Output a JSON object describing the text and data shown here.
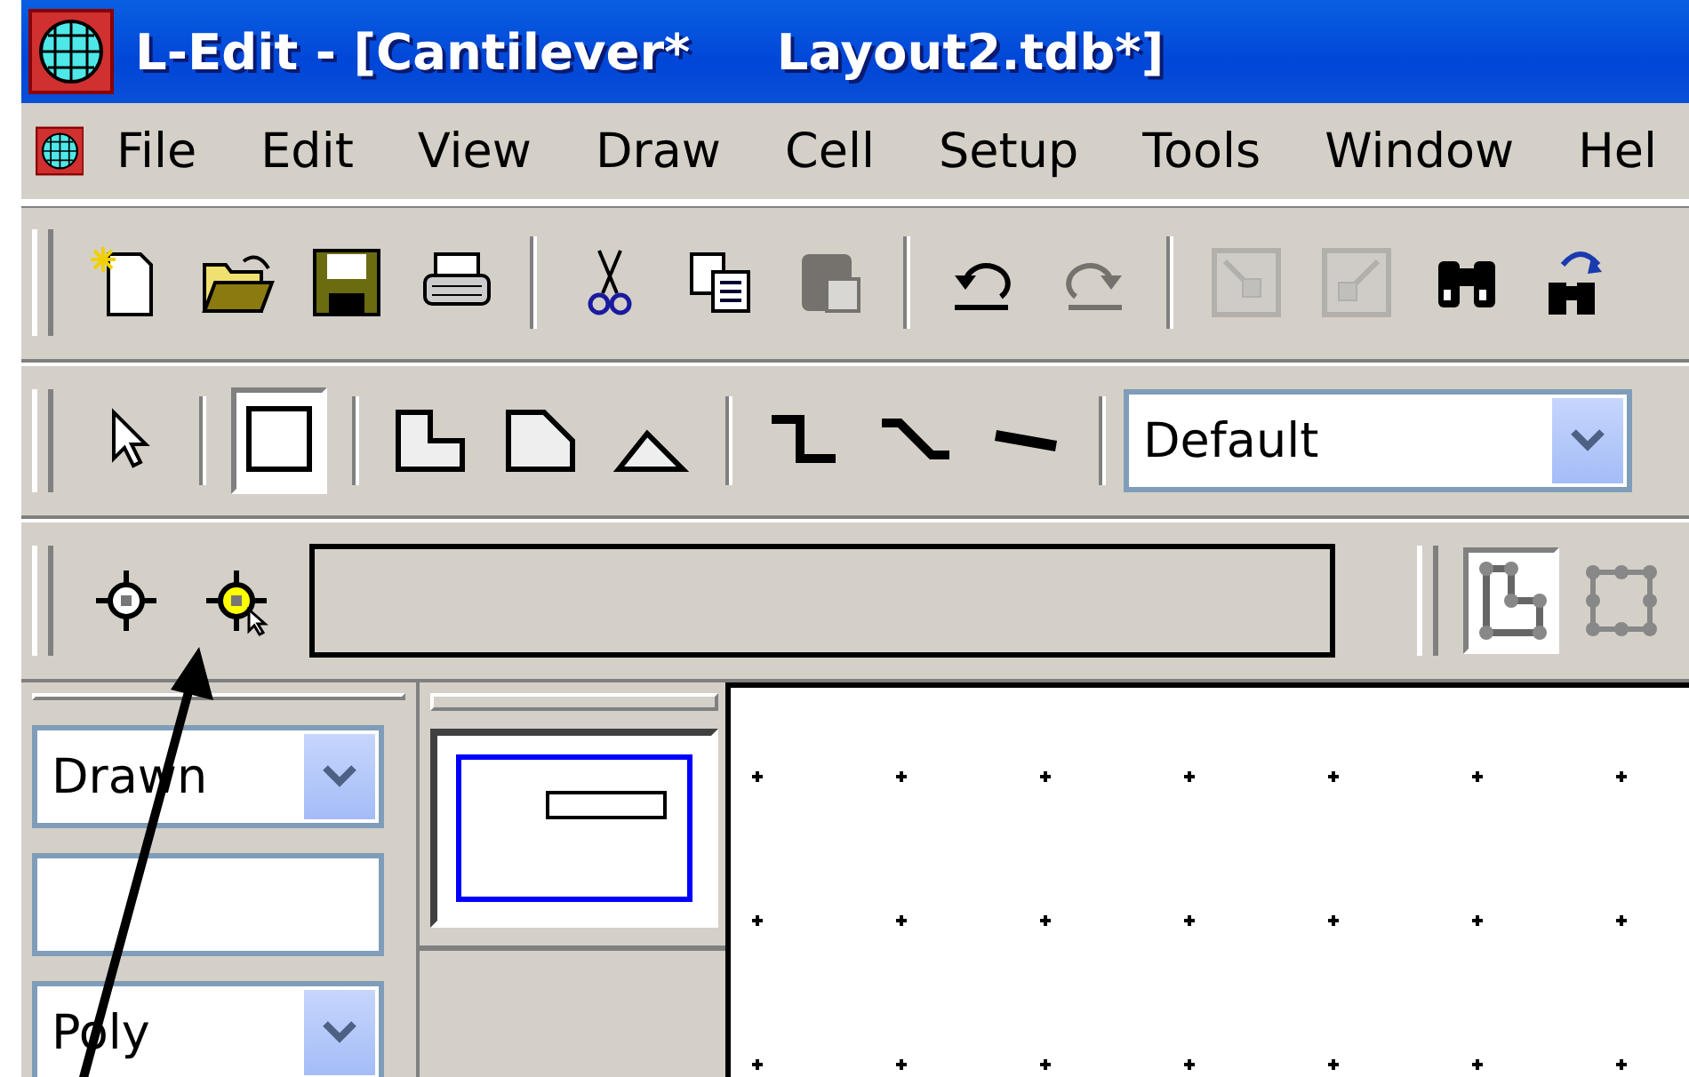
{
  "window": {
    "title": "L-Edit - [Cantilever*     Layout2.tdb*]"
  },
  "menu": [
    "File",
    "Edit",
    "View",
    "Draw",
    "Cell",
    "Setup",
    "Tools",
    "Window",
    "Hel"
  ],
  "standard_toolbar": [
    {
      "kind": "new",
      "disabled": false
    },
    {
      "kind": "open",
      "disabled": false
    },
    {
      "kind": "save",
      "disabled": false
    },
    {
      "kind": "print",
      "disabled": false
    },
    {
      "kind": "sep"
    },
    {
      "kind": "cut",
      "disabled": false
    },
    {
      "kind": "copy",
      "disabled": false
    },
    {
      "kind": "paste",
      "disabled": true
    },
    {
      "kind": "sep"
    },
    {
      "kind": "undo",
      "disabled": false
    },
    {
      "kind": "redo",
      "disabled": true
    },
    {
      "kind": "sep"
    },
    {
      "kind": "zoom-in",
      "disabled": true
    },
    {
      "kind": "zoom-out",
      "disabled": true
    },
    {
      "kind": "find",
      "disabled": false
    },
    {
      "kind": "find-next",
      "disabled": false
    }
  ],
  "drawing_toolbar": [
    {
      "kind": "select",
      "selected": false
    },
    {
      "kind": "box",
      "selected": true
    },
    {
      "kind": "orthogonal",
      "selected": false
    },
    {
      "kind": "polygon45",
      "selected": false
    },
    {
      "kind": "triangle",
      "selected": false
    },
    {
      "kind": "wire-ortho",
      "selected": false
    },
    {
      "kind": "wire-45",
      "selected": false
    },
    {
      "kind": "wire-any",
      "selected": false
    }
  ],
  "style_dropdown": {
    "value": "Default"
  },
  "edit_toolbar": [
    {
      "kind": "edit-edges"
    },
    {
      "kind": "edit-vertices"
    }
  ],
  "layer_panel": {
    "view_dropdown": {
      "value": "Drawn"
    },
    "layer_dropdown": {
      "value": "Poly"
    }
  }
}
